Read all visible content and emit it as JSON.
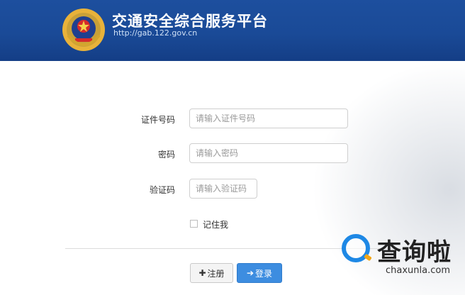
{
  "header": {
    "title": "交通安全综合服务平台",
    "url": "http://gab.122.gov.cn"
  },
  "form": {
    "id_label": "证件号码",
    "id_placeholder": "请输入证件号码",
    "password_label": "密码",
    "password_placeholder": "请输入密码",
    "captcha_label": "验证码",
    "captcha_placeholder": "请输入验证码",
    "remember_label": "记住我"
  },
  "buttons": {
    "register_icon": "✚",
    "register_label": "注册",
    "login_icon": "➔",
    "login_label": "登录"
  },
  "watermark": {
    "main": "查询啦",
    "sub": "chaxunla.com"
  },
  "colors": {
    "header_blue": "#1a4a97",
    "login_blue": "#3d8de0",
    "watermark_blue": "#1e88e5",
    "watermark_orange": "#f2a516"
  }
}
